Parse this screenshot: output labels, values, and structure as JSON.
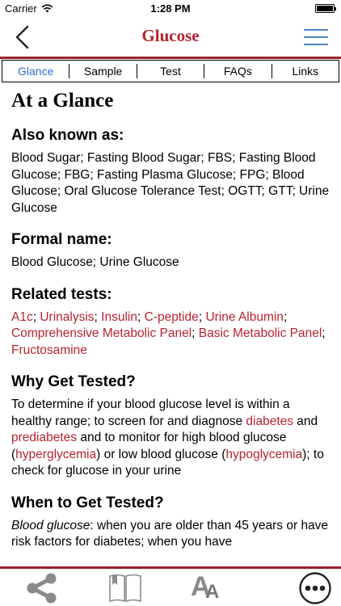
{
  "status_bar": {
    "carrier": "Carrier",
    "time": "1:28 PM",
    "battery_level": 1.0
  },
  "nav": {
    "title": "Glucose",
    "back_icon": "chevron-left-icon",
    "menu_icon": "hamburger-menu-icon",
    "title_color": "#b8232f",
    "accent_color": "#9c2231"
  },
  "tabs": [
    {
      "label": "Glance",
      "active": true
    },
    {
      "label": "Sample",
      "active": false
    },
    {
      "label": "Test",
      "active": false
    },
    {
      "label": "FAQs",
      "active": false
    },
    {
      "label": "Links",
      "active": false
    }
  ],
  "content": {
    "title": "At a Glance",
    "aka_heading": "Also known as:",
    "aka_text": "Blood Sugar; Fasting Blood Sugar; FBS; Fasting Blood Glucose; FBG; Fasting Plasma Glucose; FPG; Blood Glucose; Oral Glucose Tolerance Test; OGTT; GTT; Urine Glucose",
    "formal_heading": "Formal name:",
    "formal_text": "Blood Glucose; Urine Glucose",
    "related_heading": "Related tests:",
    "related": {
      "a1c": "A1c",
      "urinalysis": "Urinalysis",
      "insulin": "Insulin",
      "cpeptide": "C-peptide",
      "urine_albumin": "Urine Albumin",
      "cmp": "Comprehensive Metabolic Panel",
      "bmp": "Basic Metabolic Panel",
      "fructosamine": "Fructosamine",
      "sep": "; ",
      "end_sep": ";"
    },
    "why_heading": "Why Get Tested?",
    "why": {
      "t1": "To determine if your blood glucose level is within a healthy range; to screen for and diagnose ",
      "diabetes": "diabetes",
      "t2": " and ",
      "prediabetes": "prediabetes",
      "t3": " and to monitor for high blood glucose (",
      "hyperglycemia": "hyperglycemia",
      "t4": ") or low blood glucose (",
      "hypoglycemia": "hypoglycemia",
      "t5": "); to check for glucose in your urine"
    },
    "when_heading": "When to Get Tested?",
    "when": {
      "label": "Blood glucose",
      "text": ": when you are older than 45 years or have risk factors for diabetes; when you have"
    }
  },
  "toolbar": {
    "share_icon": "share-icon",
    "book_icon": "book-icon",
    "text_size_label_big": "A",
    "text_size_label_small": "A",
    "more_icon": "more-circle-icon"
  }
}
